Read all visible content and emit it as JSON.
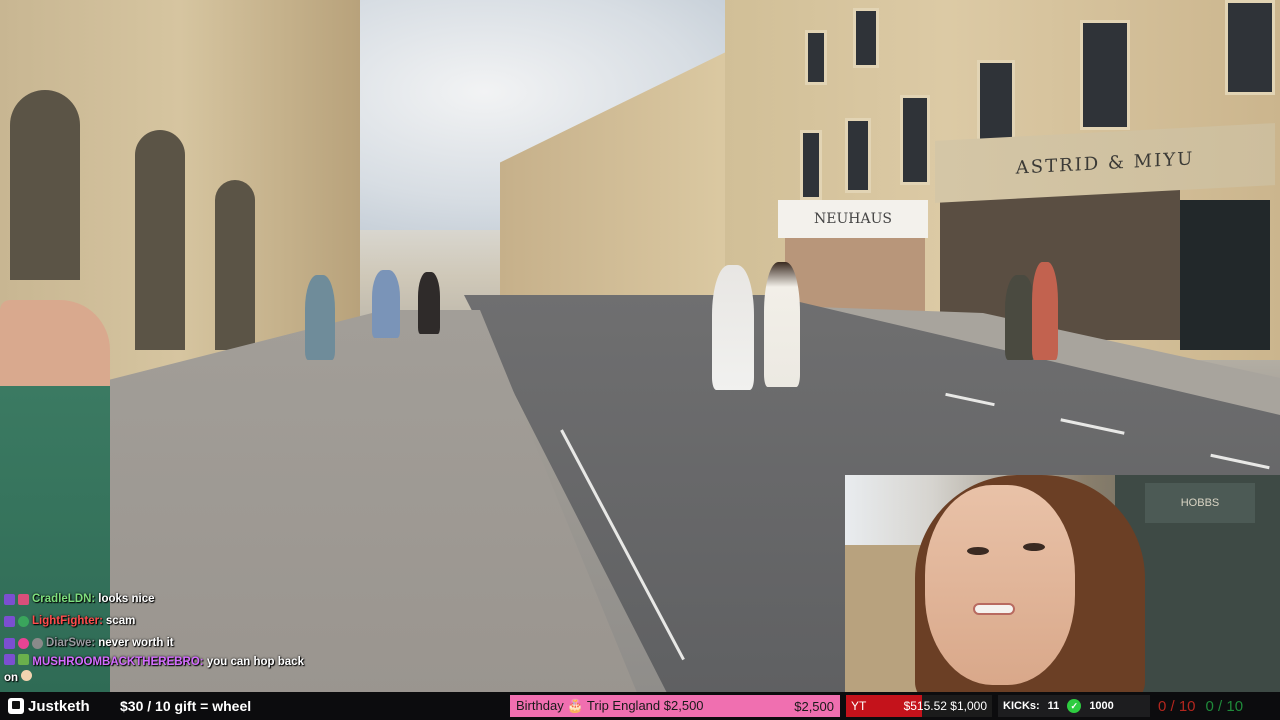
{
  "scene": {
    "shop_sign_1": "ASTRID & MIYU",
    "shop_sign_2": "NEUHAUS"
  },
  "webcam": {
    "shop_sign": "HOBBS"
  },
  "chat": [
    {
      "user": "CradleLDN:",
      "user_color": "#7ee07e",
      "message": "looks nice"
    },
    {
      "user": "LightFighter:",
      "user_color": "#ff4d4d",
      "message": "scam"
    },
    {
      "user": "DiarSwe:",
      "user_color": "#9a9aa0",
      "message": "never worth it"
    },
    {
      "user": "MUSHROOMBACKTHEREBRO:",
      "user_color": "#d46cff",
      "message": "you can hop back on"
    }
  ],
  "bar": {
    "logo": "Justketh",
    "gift_text": "$30 / 10 gift = wheel",
    "birthday_goal": {
      "label": "Birthday",
      "label2": "Trip England",
      "goal": "$2,500",
      "right": "$2,500"
    },
    "yt_goal": {
      "label": "YT",
      "current": "$515.52",
      "goal": "$1,000",
      "progress": 0.52
    },
    "kicks": {
      "label": "KICKs:",
      "count": "11",
      "amount": "1000"
    },
    "counter_red": "0 / 10",
    "counter_green": "0 / 10"
  },
  "colors": {
    "birthday_bar": "#f06fb0",
    "yt_bar": "#c4121b",
    "kick_green": "#2ecc40"
  }
}
